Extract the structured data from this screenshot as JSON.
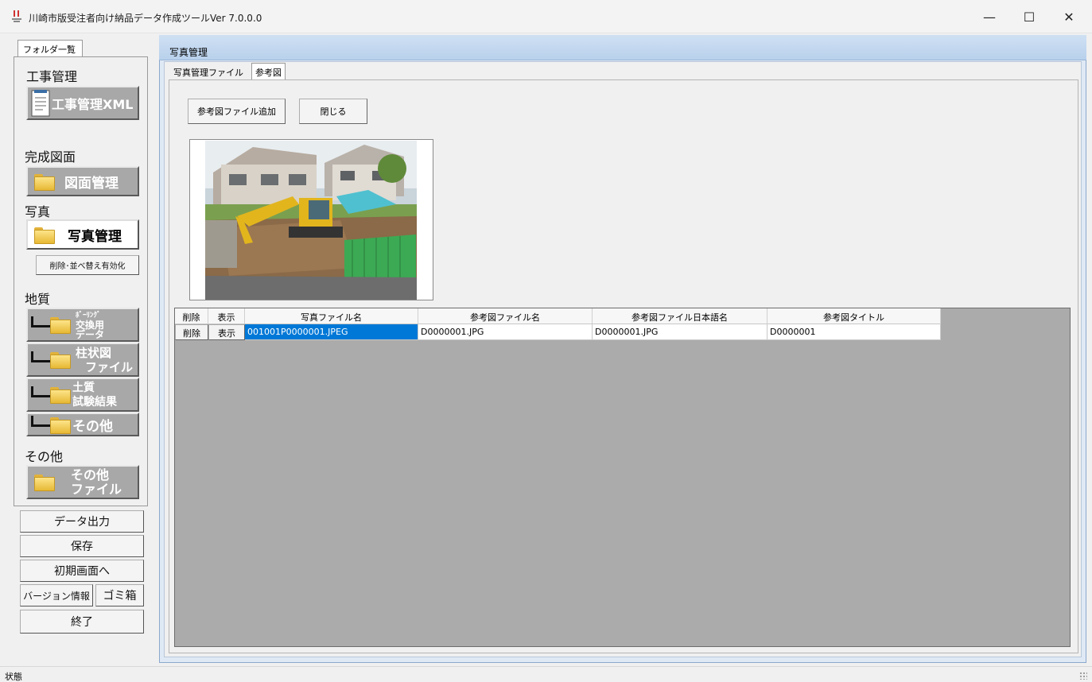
{
  "window": {
    "title": "川崎市版受注者向け納品データ作成ツールVer 7.0.0.0",
    "minimize": "—",
    "maximize": "☐",
    "close": "✕"
  },
  "sidebar": {
    "tab_label": "フォルダ一覧",
    "sections": {
      "koji": "工事管理",
      "kansei": "完成図面",
      "shashin": "写真",
      "chishitsu": "地質",
      "sonota": "その他"
    },
    "buttons": {
      "koji_xml": "工事管理XML",
      "zumen": "図面管理",
      "shashin": "写真管理",
      "sakujo_narabekae": "削除･並べ替え有効化",
      "boring_1": "ﾎﾞｰﾘﾝｸﾞ",
      "boring_2": "交換用",
      "boring_3": "データ",
      "chujozu_1": "柱状図",
      "chujozu_2": "ファイル",
      "doshitsu_1": "土質",
      "doshitsu_2": "試験結果",
      "chishitsu_sonota": "その他",
      "sonota_1": "その他",
      "sonota_2": "ファイル"
    },
    "bottom": {
      "data_output": "データ出力",
      "save": "保存",
      "initial": "初期画面へ",
      "version": "バージョン情報",
      "trash": "ゴミ箱",
      "exit": "終了"
    }
  },
  "main": {
    "title": "写真管理",
    "tabs": [
      "写真管理ファイル",
      "参考図"
    ],
    "active_tab": 1,
    "add_button": "参考図ファイル追加",
    "close_button": "閉じる",
    "grid": {
      "columns": [
        "削除",
        "表示",
        "写真ファイル名",
        "参考図ファイル名",
        "参考図ファイル日本語名",
        "参考図タイトル"
      ],
      "rows": [
        [
          "削除",
          "表示",
          "001001P0000001.JPEG",
          "D0000001.JPG",
          "D0000001.JPG",
          "D0000001"
        ]
      ]
    }
  },
  "status": "状態"
}
